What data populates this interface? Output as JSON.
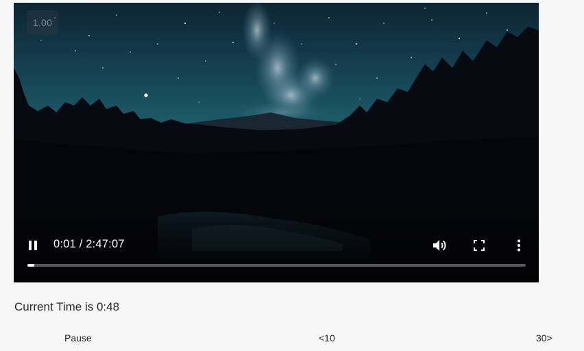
{
  "player": {
    "playback_rate": "1.00",
    "time_display": "0:01 / 2:47:07",
    "progress_fraction": 0.014,
    "icons": {
      "play_pause": "pause-icon",
      "volume": "volume-icon",
      "fullscreen": "fullscreen-icon",
      "more": "more-vert-icon"
    }
  },
  "status": {
    "current_time_text": "Current Time is 0:48"
  },
  "buttons": {
    "pause_label": "Pause",
    "rewind_label": "<10",
    "forward_label": "30>"
  },
  "colors": {
    "page_background": "#f7f7f7",
    "sky_top": "#0f2a3a",
    "sky_horizon": "#1f5a6a",
    "forest": "#07080f"
  }
}
